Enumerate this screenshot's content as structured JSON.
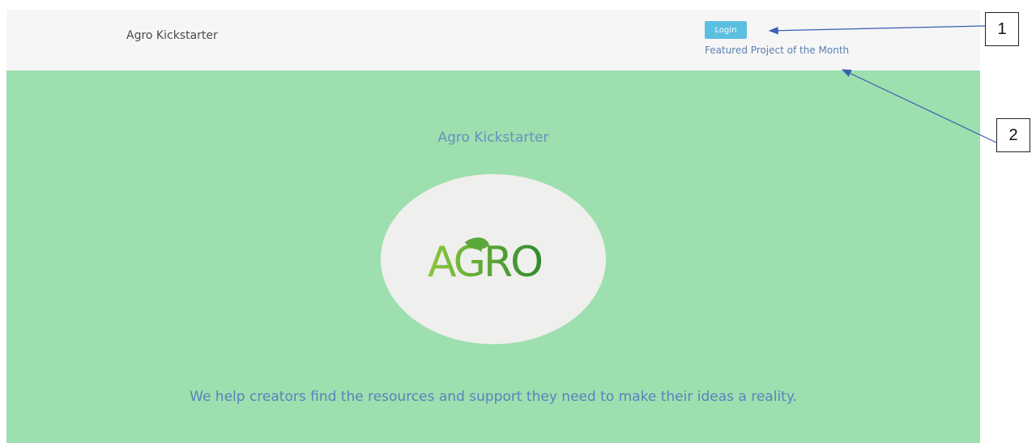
{
  "header": {
    "brand": "Agro Kickstarter",
    "login_label": "Login",
    "featured_label": "Featured Project of the Month"
  },
  "hero": {
    "title": "Agro Kickstarter",
    "logo_text": "AGRO",
    "tagline": "We help creators find the resources and support they need to make their ideas a reality."
  },
  "callouts": [
    "1",
    "2"
  ],
  "colors": {
    "header_bg": "#f6f6f6",
    "hero_bg": "#9ddfae",
    "login_button": "#5bbfe0",
    "link_text": "#5a7fb0",
    "logo_green_dark": "#2e8b2e",
    "logo_green_light": "#8cc63f",
    "arrow": "#3a5fb5"
  }
}
